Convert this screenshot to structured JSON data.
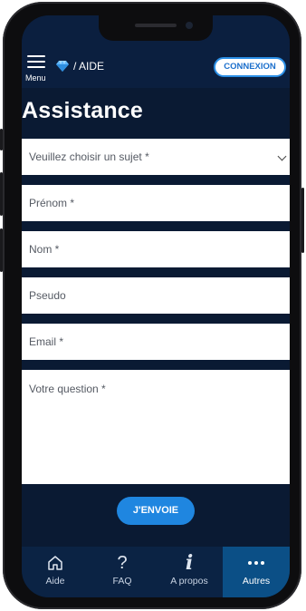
{
  "header": {
    "menu_label": "Menu",
    "breadcrumb": "/ AIDE",
    "login_label": "CONNEXION"
  },
  "page": {
    "title": "Assistance"
  },
  "form": {
    "subject_placeholder": "Veuillez choisir un sujet *",
    "firstname_placeholder": "Prénom *",
    "lastname_placeholder": "Nom *",
    "nickname_placeholder": "Pseudo",
    "email_placeholder": "Email *",
    "question_placeholder": "Votre question *",
    "submit_label": "J'ENVOIE"
  },
  "tabbar": {
    "items": [
      {
        "label": "Aide",
        "icon": "home-icon"
      },
      {
        "label": "FAQ",
        "icon": "question-icon",
        "glyph": "?"
      },
      {
        "label": "A propos",
        "icon": "info-icon",
        "glyph": "i"
      },
      {
        "label": "Autres",
        "icon": "more-dots-icon",
        "active": true
      }
    ]
  },
  "colors": {
    "background": "#0a1a33",
    "topbar": "#0b1f3f",
    "accent": "#1f86e0",
    "tab_active": "#0b4f86"
  }
}
